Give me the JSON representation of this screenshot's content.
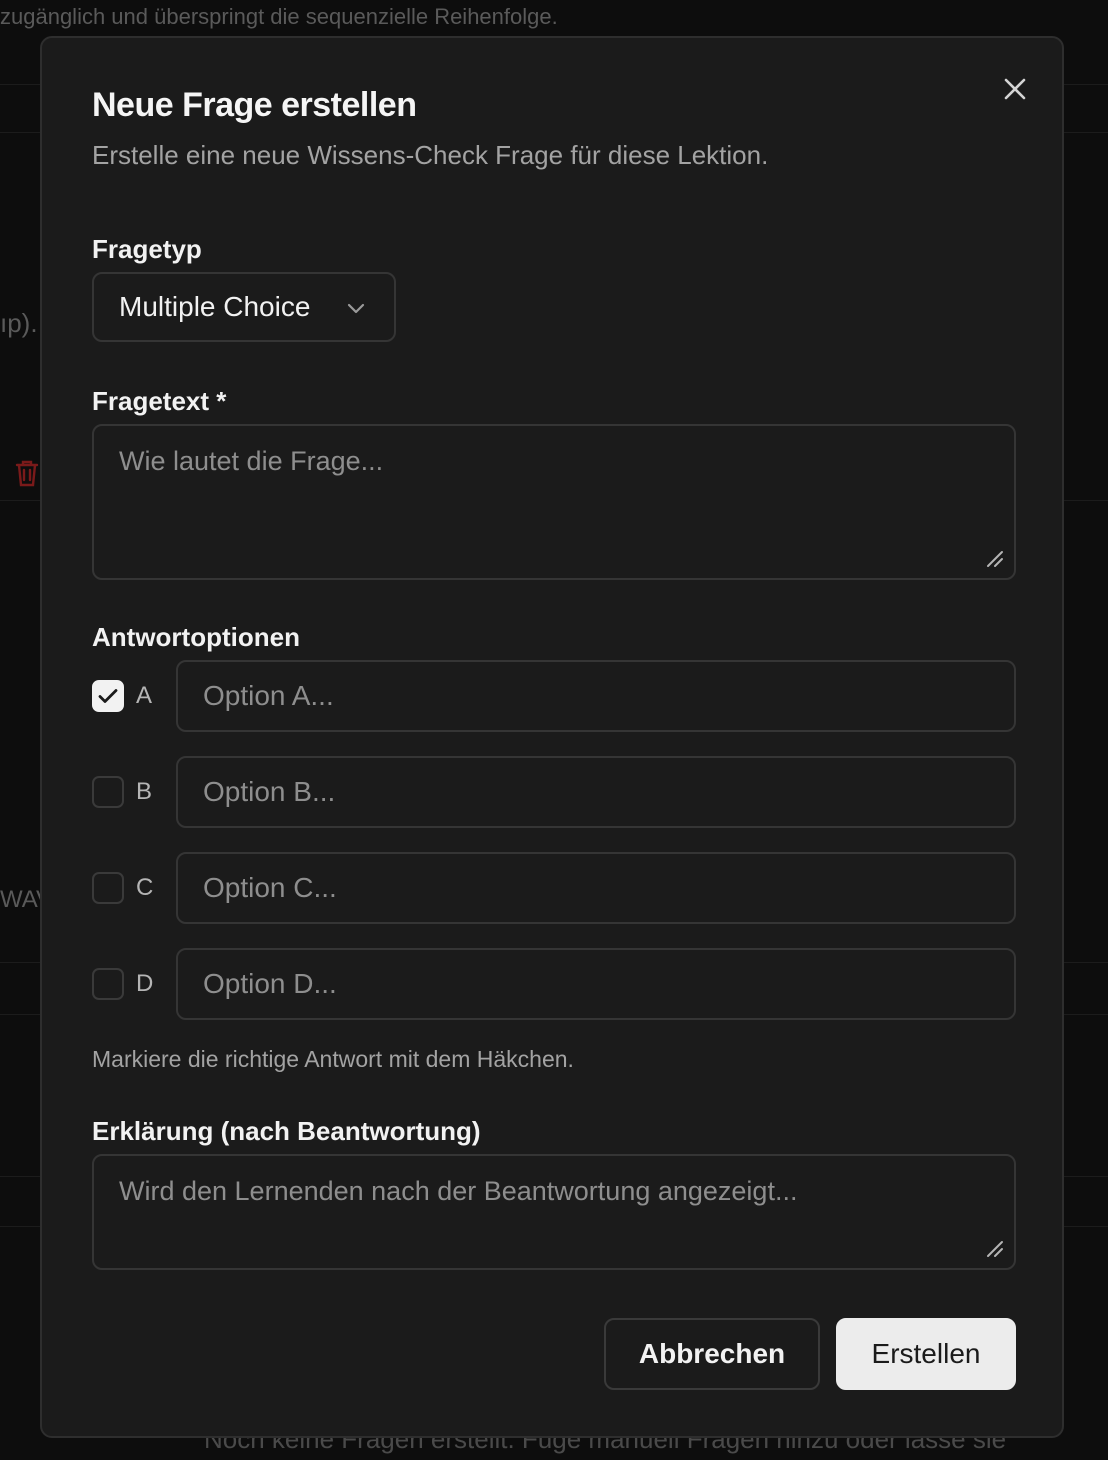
{
  "background": {
    "top_text": "zugänglich und überspringt die sequenzielle Reihenfolge.",
    "left_fragment_1": "ıp).",
    "left_fragment_2": "WAV",
    "bottom_text": "Noch keine Fragen erstellt. Füge manuell Fragen hinzu oder lasse sie"
  },
  "dialog": {
    "title": "Neue Frage erstellen",
    "subtitle": "Erstelle eine neue Wissens-Check Frage für diese Lektion.",
    "close_icon": "close-icon",
    "question_type": {
      "label": "Fragetyp",
      "value": "Multiple Choice"
    },
    "question_text": {
      "label": "Fragetext *",
      "placeholder": "Wie lautet die Frage..."
    },
    "answers": {
      "label": "Antwortoptionen",
      "options": [
        {
          "letter": "A",
          "placeholder": "Option A...",
          "checked": true
        },
        {
          "letter": "B",
          "placeholder": "Option B...",
          "checked": false
        },
        {
          "letter": "C",
          "placeholder": "Option C...",
          "checked": false
        },
        {
          "letter": "D",
          "placeholder": "Option D...",
          "checked": false
        }
      ],
      "hint": "Markiere die richtige Antwort mit dem Häkchen."
    },
    "explanation": {
      "label": "Erklärung (nach Beantwortung)",
      "placeholder": "Wird den Lernenden nach der Beantwortung angezeigt..."
    },
    "buttons": {
      "cancel": "Abbrechen",
      "create": "Erstellen"
    }
  },
  "colors": {
    "overlay_bg": "#0d0d0d",
    "dialog_bg": "#1b1b1b",
    "border": "#353535",
    "primary_button_bg": "#ececec",
    "danger_icon": "#b91c1c"
  }
}
